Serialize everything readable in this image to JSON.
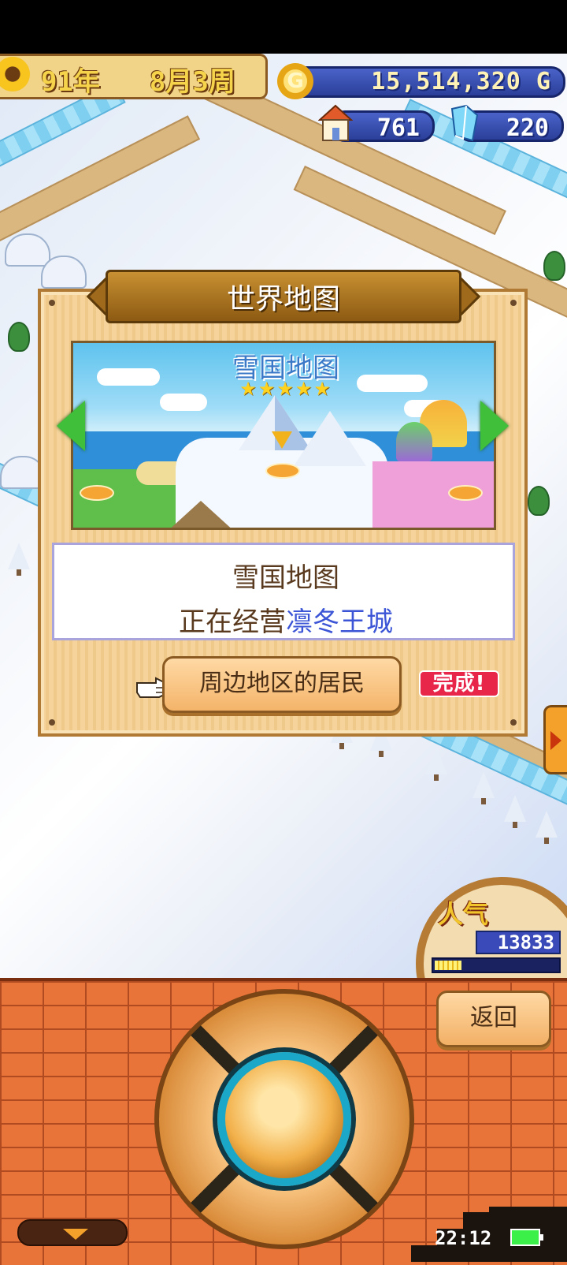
{
  "hud": {
    "year": "91年",
    "month_week": "8月3周",
    "money": "15,514,320 G",
    "houses": "761",
    "crystals": "220"
  },
  "dialog": {
    "title": "世界地图",
    "map_name": "雪国地图",
    "stars": "★★★★★",
    "info_map_name": "雪国地图",
    "managing_prefix": "正在经营",
    "managing_city": "凛冬王城",
    "residents_button": "周边地区的居民",
    "complete_badge": "完成!"
  },
  "popularity": {
    "label": "人气",
    "value": "13833",
    "bar_level": 0.22
  },
  "panel": {
    "back_button": "返回"
  },
  "status": {
    "time": "22:12"
  },
  "colors": {
    "accent_blue": "#3b55d6",
    "badge_red": "#e8264a",
    "brick_orange": "#e8743a"
  }
}
